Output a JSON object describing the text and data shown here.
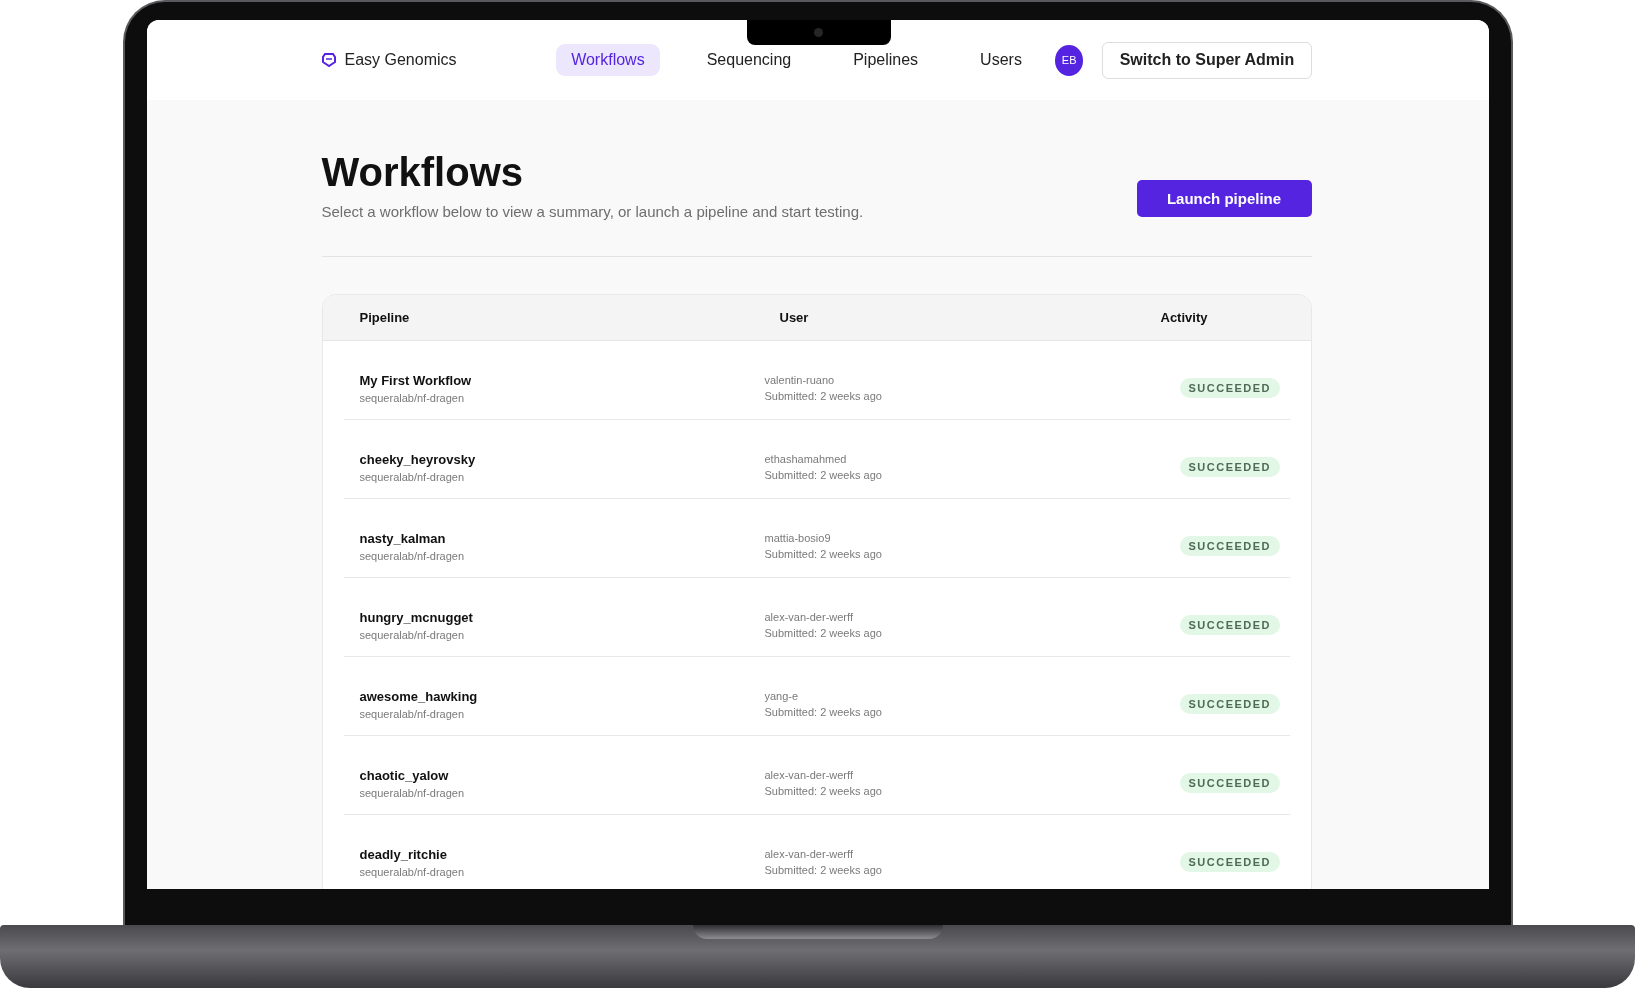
{
  "brand": {
    "name": "Easy Genomics"
  },
  "nav": [
    {
      "label": "Workflows",
      "selected": true
    },
    {
      "label": "Sequencing",
      "selected": false
    },
    {
      "label": "Pipelines",
      "selected": false
    },
    {
      "label": "Users",
      "selected": false
    }
  ],
  "avatar": {
    "initials": "EB"
  },
  "switch_button": {
    "label": "Switch to Super Admin"
  },
  "header": {
    "title": "Workflows",
    "subtitle": "Select a workflow below to view a summary, or launch a pipeline and start testing.",
    "action": "Launch pipeline"
  },
  "table": {
    "columns": [
      "Pipeline",
      "User",
      "Activity"
    ],
    "rows": [
      {
        "name": "My First Workflow",
        "pipeline": "sequeralab/nf-dragen",
        "user": "valentin-ruano",
        "submitted": "Submitted: 2 weeks ago",
        "activity": "SUCCEEDED"
      },
      {
        "name": "cheeky_heyrovsky",
        "pipeline": "sequeralab/nf-dragen",
        "user": "ethashamahmed",
        "submitted": "Submitted: 2 weeks ago",
        "activity": "SUCCEEDED"
      },
      {
        "name": "nasty_kalman",
        "pipeline": "sequeralab/nf-dragen",
        "user": "mattia-bosio9",
        "submitted": "Submitted: 2 weeks ago",
        "activity": "SUCCEEDED"
      },
      {
        "name": "hungry_mcnugget",
        "pipeline": "sequeralab/nf-dragen",
        "user": "alex-van-der-werff",
        "submitted": "Submitted: 2 weeks ago",
        "activity": "SUCCEEDED"
      },
      {
        "name": "awesome_hawking",
        "pipeline": "sequeralab/nf-dragen",
        "user": "yang-e",
        "submitted": "Submitted: 2 weeks ago",
        "activity": "SUCCEEDED"
      },
      {
        "name": "chaotic_yalow",
        "pipeline": "sequeralab/nf-dragen",
        "user": "alex-van-der-werff",
        "submitted": "Submitted: 2 weeks ago",
        "activity": "SUCCEEDED"
      },
      {
        "name": "deadly_ritchie",
        "pipeline": "sequeralab/nf-dragen",
        "user": "alex-van-der-werff",
        "submitted": "Submitted: 2 weeks ago",
        "activity": "SUCCEEDED"
      }
    ]
  }
}
